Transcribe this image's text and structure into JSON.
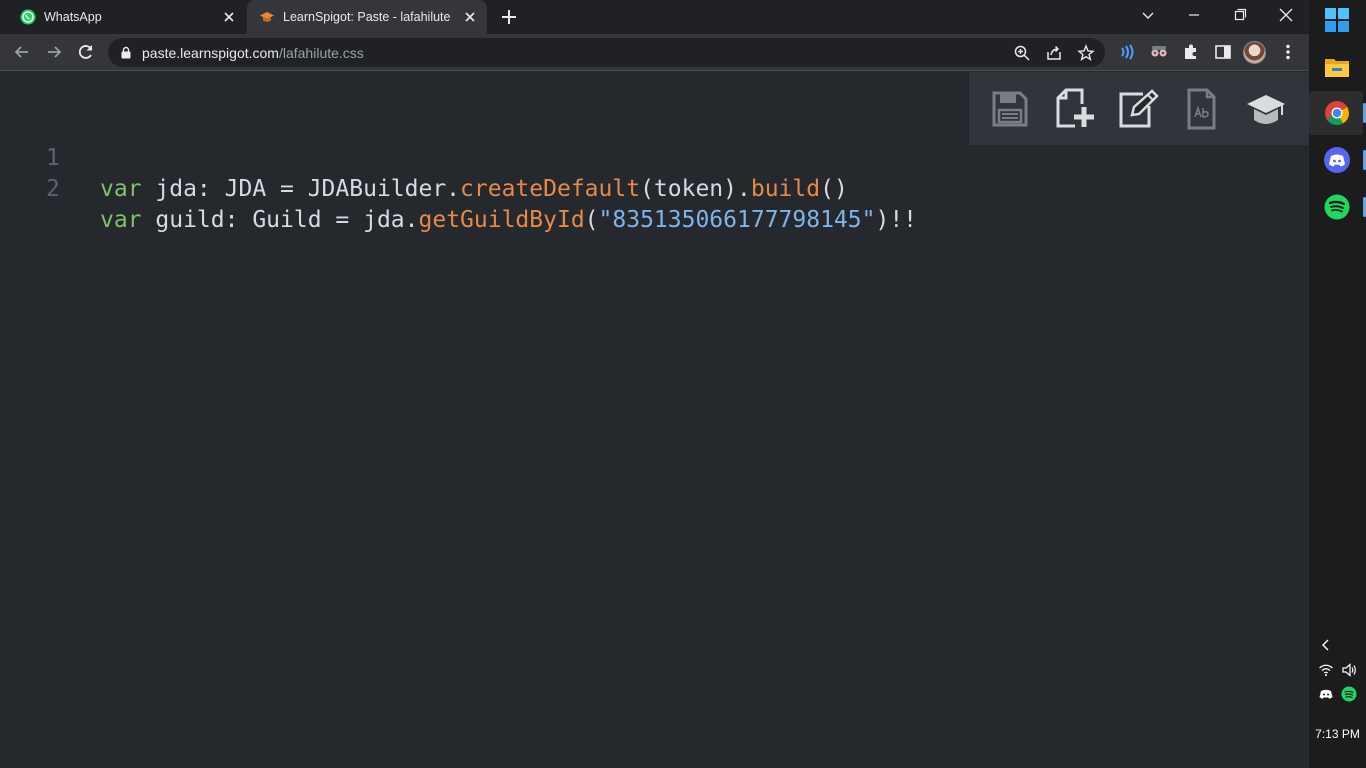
{
  "tabs": [
    {
      "title": "WhatsApp",
      "icon": "whatsapp-icon",
      "active": false
    },
    {
      "title": "LearnSpigot: Paste - lafahilute",
      "icon": "graduation-cap-icon",
      "active": true
    }
  ],
  "address_bar": {
    "host": "paste.learnspigot.com",
    "path": "/lafahilute.css"
  },
  "code": {
    "line_numbers": [
      "1",
      "2"
    ],
    "line1": {
      "kw": "var",
      "decl": " jda: JDA = JDABuilder.",
      "fn1": "createDefault",
      "mid": "(token).",
      "fn2": "build",
      "end": "()"
    },
    "line2": {
      "kw": "var",
      "decl": " guild: Guild = jda.",
      "fn": "getGuildById",
      "open": "(",
      "str": "\"835135066177798145\"",
      "end": ")!!"
    }
  },
  "paste_actions": [
    "save-icon",
    "new-paste-icon",
    "edit-icon",
    "raw-text-icon",
    "graduation-cap-icon"
  ],
  "taskbar": {
    "apps": [
      "start-icon",
      "file-explorer-icon",
      "chrome-icon",
      "discord-icon",
      "spotify-icon"
    ],
    "clock": "7:13 PM"
  },
  "colors": {
    "keyword": "#7ec16e",
    "function": "#e5894b",
    "string": "#7fb4e6",
    "editor_bg": "#25282d"
  }
}
